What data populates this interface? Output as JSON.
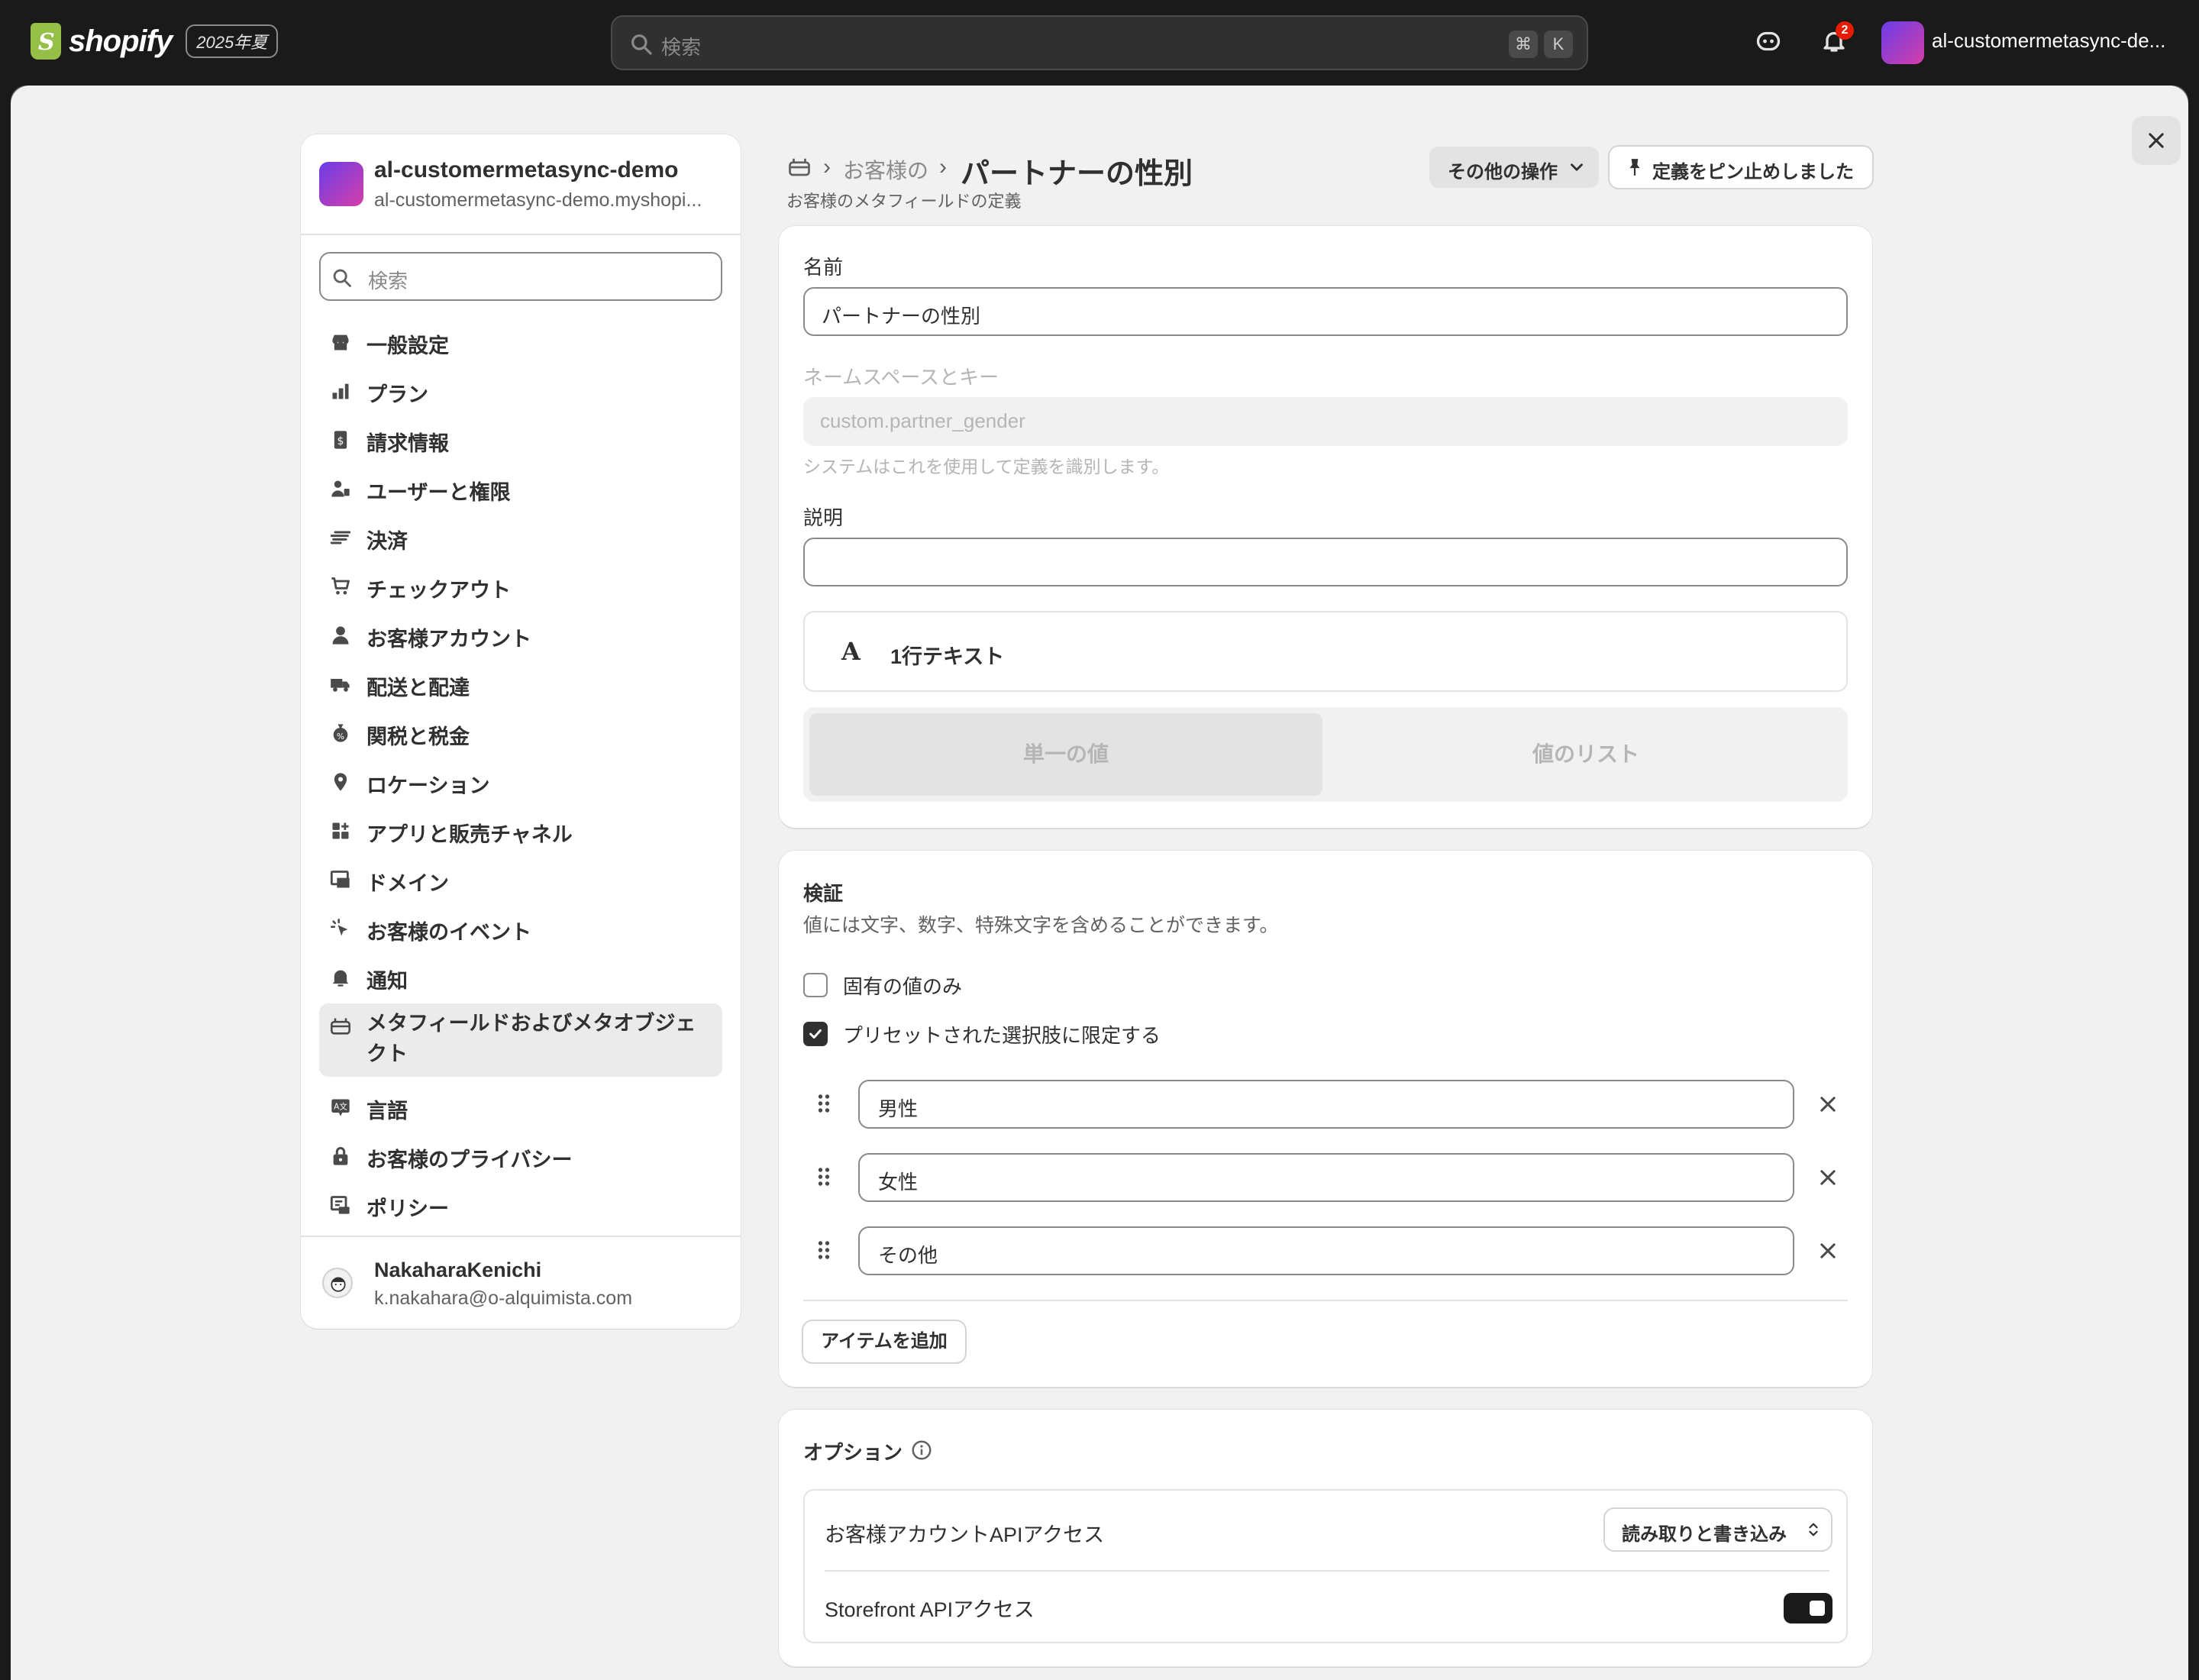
{
  "topbar": {
    "brand": "shopify",
    "edition_badge": "2025年夏",
    "search_placeholder": "検索",
    "shortcut_cmd": "⌘",
    "shortcut_key": "K",
    "notification_count": "2",
    "store_name": "al-customermetasync-de..."
  },
  "nav": {
    "store_name": "al-customermetasync-demo",
    "store_domain": "al-customermetasync-demo.myshopi...",
    "search_placeholder": "検索",
    "items": [
      {
        "label": "一般設定",
        "icon": "store-icon"
      },
      {
        "label": "プラン",
        "icon": "plan-icon"
      },
      {
        "label": "請求情報",
        "icon": "receipt-icon"
      },
      {
        "label": "ユーザーと権限",
        "icon": "users-icon"
      },
      {
        "label": "決済",
        "icon": "payment-icon"
      },
      {
        "label": "チェックアウト",
        "icon": "cart-icon"
      },
      {
        "label": "お客様アカウント",
        "icon": "person-icon"
      },
      {
        "label": "配送と配達",
        "icon": "truck-icon"
      },
      {
        "label": "関税と税金",
        "icon": "tax-icon"
      },
      {
        "label": "ロケーション",
        "icon": "location-icon"
      },
      {
        "label": "アプリと販売チャネル",
        "icon": "apps-icon"
      },
      {
        "label": "ドメイン",
        "icon": "domain-icon"
      },
      {
        "label": "お客様のイベント",
        "icon": "cursor-icon"
      },
      {
        "label": "通知",
        "icon": "bell-icon"
      },
      {
        "label": "メタフィールドおよびメタオブジェクト",
        "icon": "metafield-icon"
      },
      {
        "label": "言語",
        "icon": "language-icon"
      },
      {
        "label": "お客様のプライバシー",
        "icon": "lock-icon"
      },
      {
        "label": "ポリシー",
        "icon": "policy-icon"
      }
    ],
    "user": {
      "name": "NakaharaKenichi",
      "email": "k.nakahara@o-alquimista.com"
    }
  },
  "header": {
    "breadcrumb_prev": "お客様の",
    "title": "パートナーの性別",
    "subtitle": "お客様のメタフィールドの定義",
    "more_actions": "その他の操作",
    "pinned": "定義をピン止めしました"
  },
  "definition": {
    "name_label": "名前",
    "name_value": "パートナーの性別",
    "namespace_label": "ネームスペースとキー",
    "namespace_value": "custom.partner_gender",
    "namespace_help": "システムはこれを使用して定義を識別します。",
    "description_label": "説明",
    "description_value": "",
    "type_icon": "A",
    "type_label": "1行テキスト",
    "single_value": "単一の値",
    "list_value": "値のリスト"
  },
  "validation": {
    "title": "検証",
    "description": "値には文字、数字、特殊文字を含めることができます。",
    "unique_label": "固有の値のみ",
    "unique_checked": false,
    "preset_label": "プリセットされた選択肢に限定する",
    "preset_checked": true,
    "choices": [
      "男性",
      "女性",
      "その他"
    ],
    "add_item": "アイテムを追加"
  },
  "options": {
    "title": "オプション",
    "customer_api_label": "お客様アカウントAPIアクセス",
    "customer_api_value": "読み取りと書き込み",
    "storefront_api_label": "Storefront APIアクセス",
    "storefront_api_enabled": true
  }
}
